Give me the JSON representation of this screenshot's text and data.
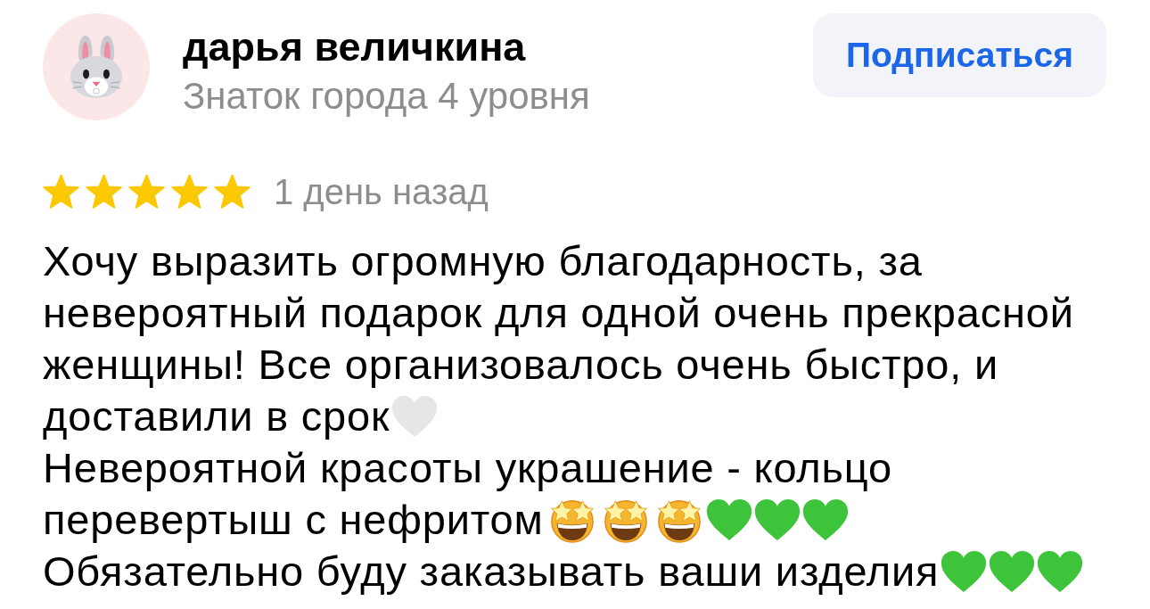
{
  "author": {
    "name": "дарья величкина",
    "status": "Знаток города 4 уровня"
  },
  "subscribe_button": {
    "label": "Подписаться"
  },
  "review": {
    "stars": 5,
    "date": "1 день назад",
    "lines": [
      {
        "parts": [
          {
            "kind": "text",
            "text": "Хочу выразить огромную благодарность, за"
          }
        ]
      },
      {
        "parts": [
          {
            "kind": "text",
            "text": "невероятный подарок для одной очень прекрасной"
          }
        ]
      },
      {
        "parts": [
          {
            "kind": "text",
            "text": "женщины! Все организовалось очень быстро, и"
          }
        ]
      },
      {
        "parts": [
          {
            "kind": "text",
            "text": "доставили в срок"
          },
          {
            "kind": "heart",
            "color": "#e6e6e6"
          }
        ]
      },
      {
        "parts": [
          {
            "kind": "text",
            "text": "Невероятной красоты украшение - кольцо"
          }
        ]
      },
      {
        "parts": [
          {
            "kind": "text",
            "text": "перевертыш с нефритом"
          },
          {
            "kind": "star_eyes_face"
          },
          {
            "kind": "star_eyes_face"
          },
          {
            "kind": "star_eyes_face"
          },
          {
            "kind": "heart",
            "color": "#3dc43a"
          },
          {
            "kind": "heart",
            "color": "#3dc43a"
          },
          {
            "kind": "heart",
            "color": "#3dc43a"
          }
        ]
      },
      {
        "parts": [
          {
            "kind": "text",
            "text": "Обязательно буду заказывать ваши изделия"
          },
          {
            "kind": "heart",
            "color": "#3dc43a"
          },
          {
            "kind": "heart",
            "color": "#3dc43a"
          },
          {
            "kind": "heart",
            "color": "#3dc43a"
          }
        ]
      }
    ]
  }
}
